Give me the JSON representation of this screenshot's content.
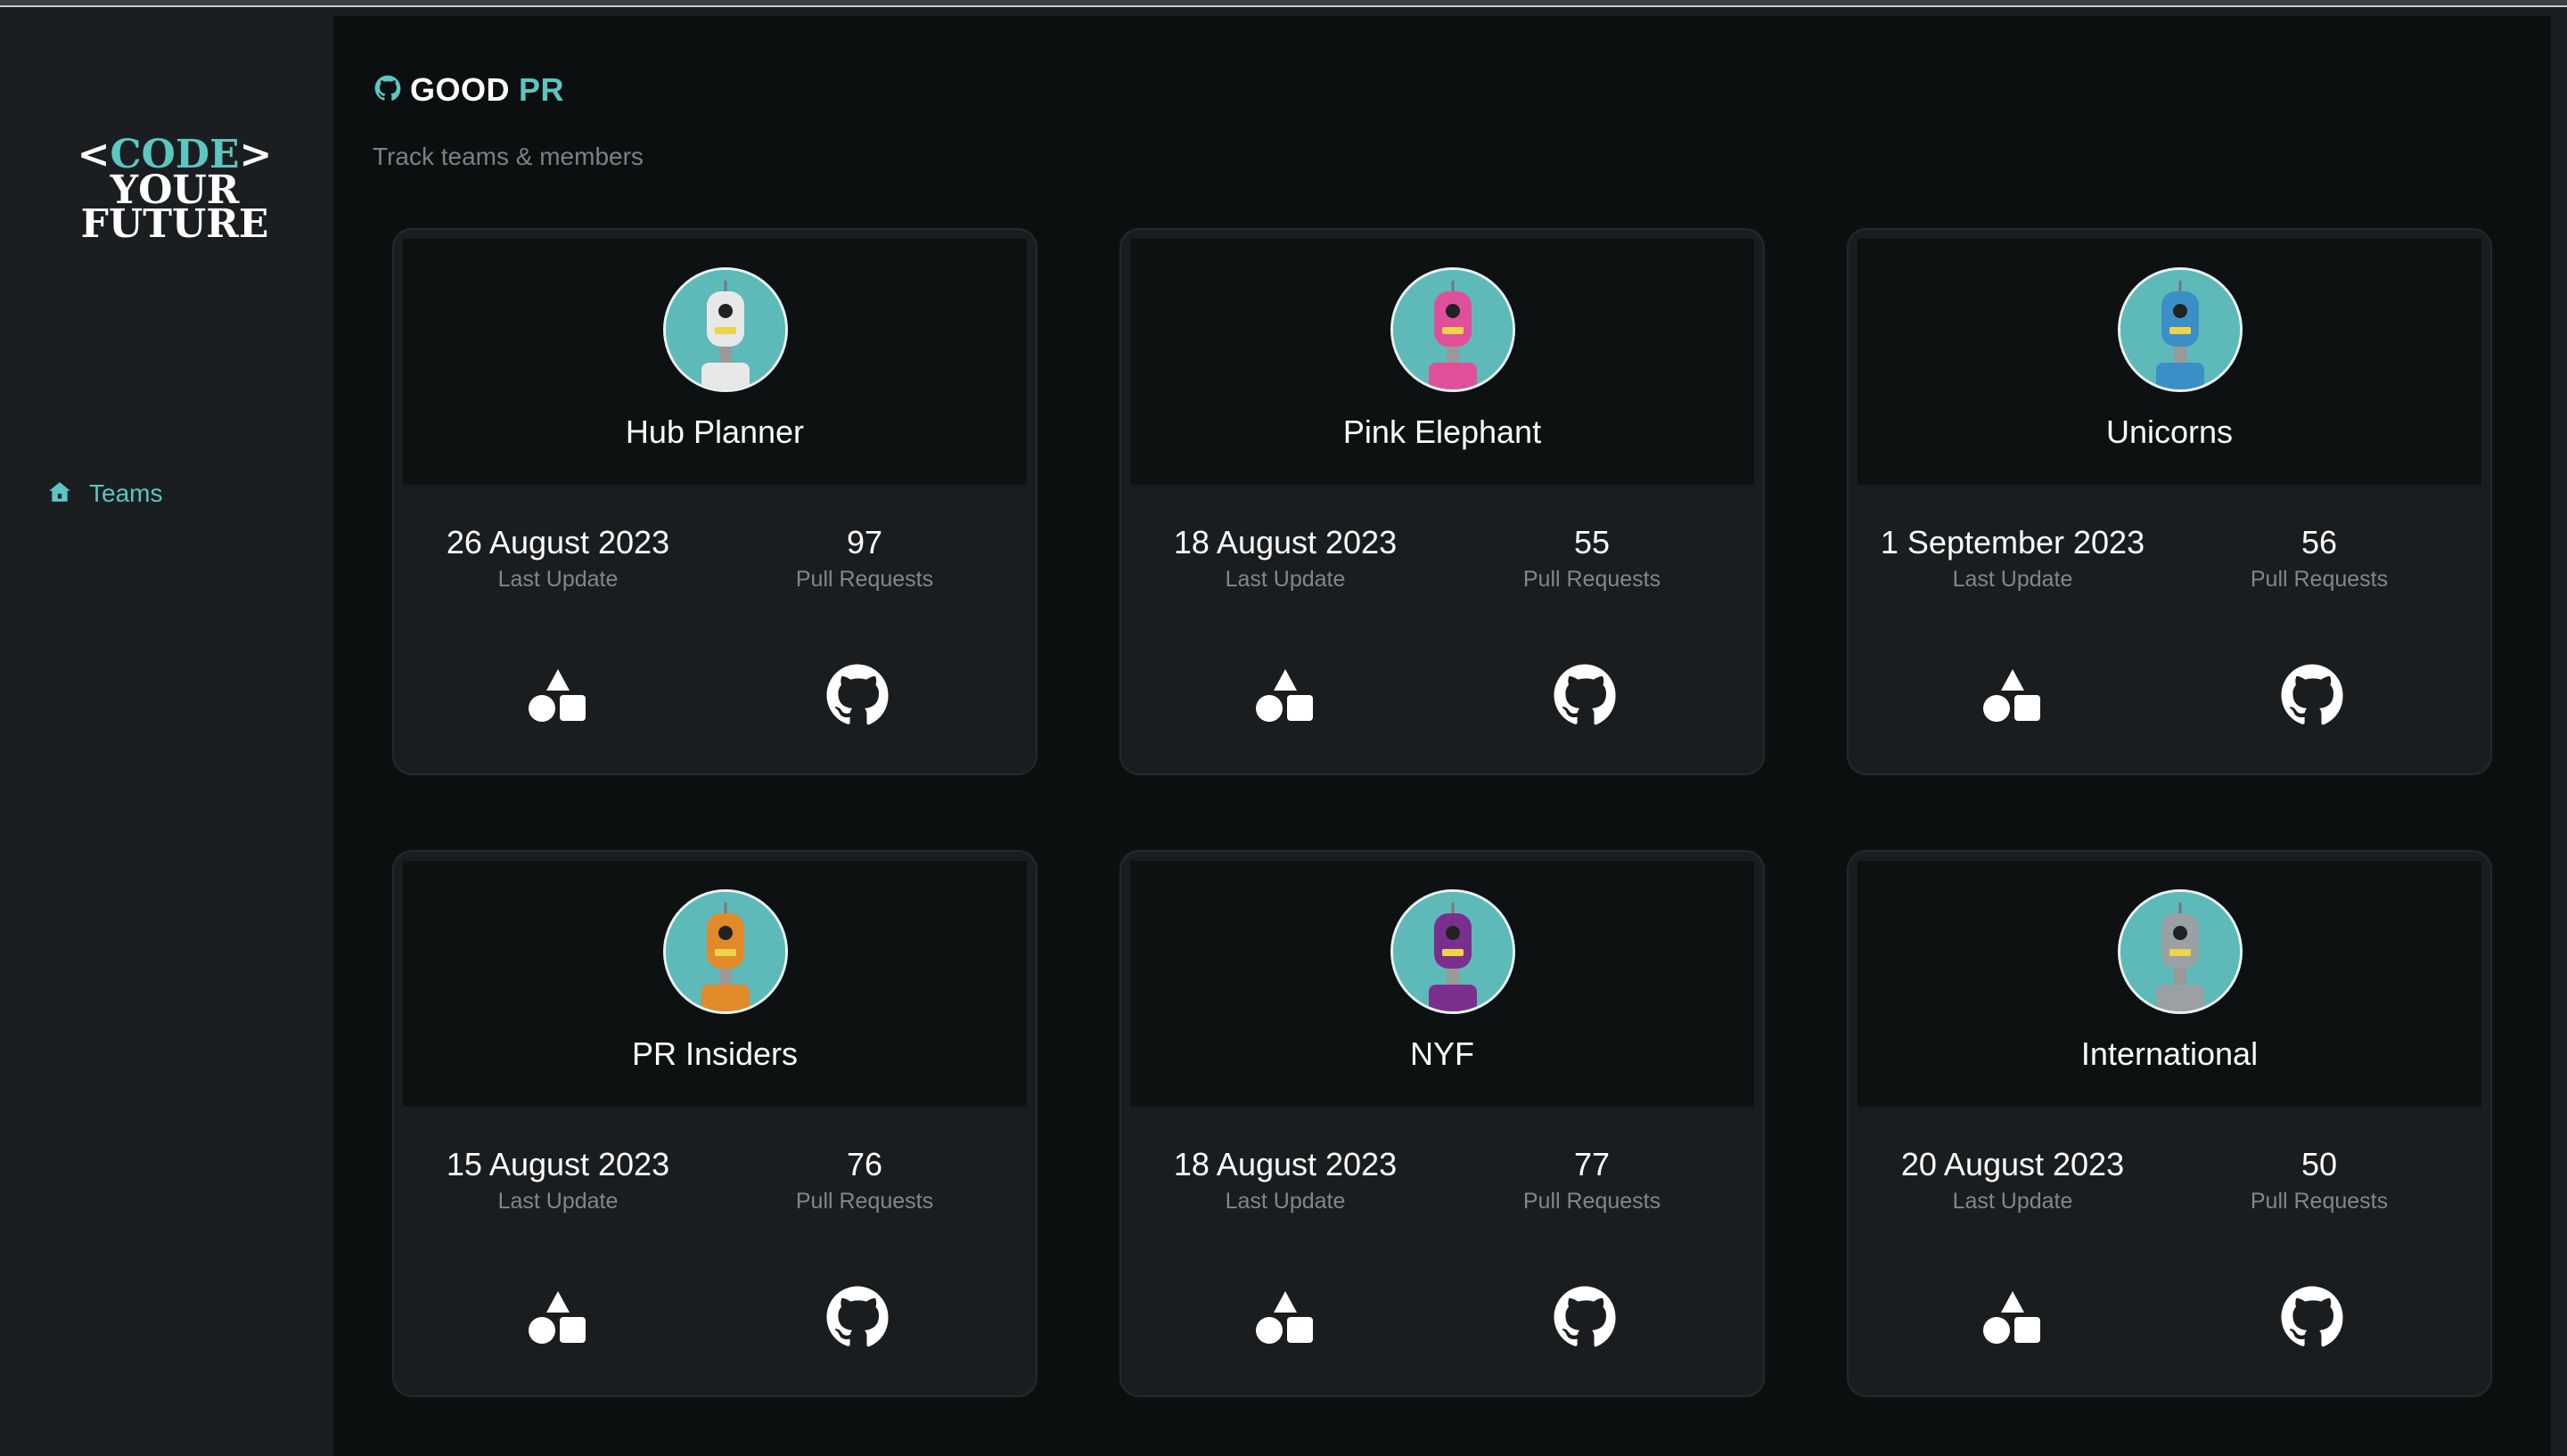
{
  "sidebar": {
    "logo": {
      "bracket_open": "<",
      "code": "CODE",
      "bracket_close": ">",
      "line2": "YOUR",
      "line3": "FUTURE"
    },
    "nav": [
      {
        "label": "Teams",
        "icon": "home-icon"
      }
    ]
  },
  "header": {
    "brand_part1": "GOOD",
    "brand_part2": "PR",
    "subtitle": "Track teams & members"
  },
  "labels": {
    "last_update": "Last Update",
    "pull_requests": "Pull Requests"
  },
  "colors": {
    "accent": "#5cc6c2",
    "background": "#0b0f10",
    "card": "#1a1d1f",
    "avatar_bg": "#5dbab8"
  },
  "teams": [
    {
      "name": "Hub Planner",
      "last_update": "26 August 2023",
      "pull_requests": "97",
      "avatar_color": "#e8e8e8"
    },
    {
      "name": "Pink Elephant",
      "last_update": "18 August 2023",
      "pull_requests": "55",
      "avatar_color": "#e0509a"
    },
    {
      "name": "Unicorns",
      "last_update": "1 September 2023",
      "pull_requests": "56",
      "avatar_color": "#3a8fc7"
    },
    {
      "name": "PR Insiders",
      "last_update": "15 August 2023",
      "pull_requests": "76",
      "avatar_color": "#e28a2a"
    },
    {
      "name": "NYF",
      "last_update": "18 August 2023",
      "pull_requests": "77",
      "avatar_color": "#7a2f8f"
    },
    {
      "name": "International",
      "last_update": "20 August 2023",
      "pull_requests": "50",
      "avatar_color": "#9aa0a3"
    }
  ]
}
